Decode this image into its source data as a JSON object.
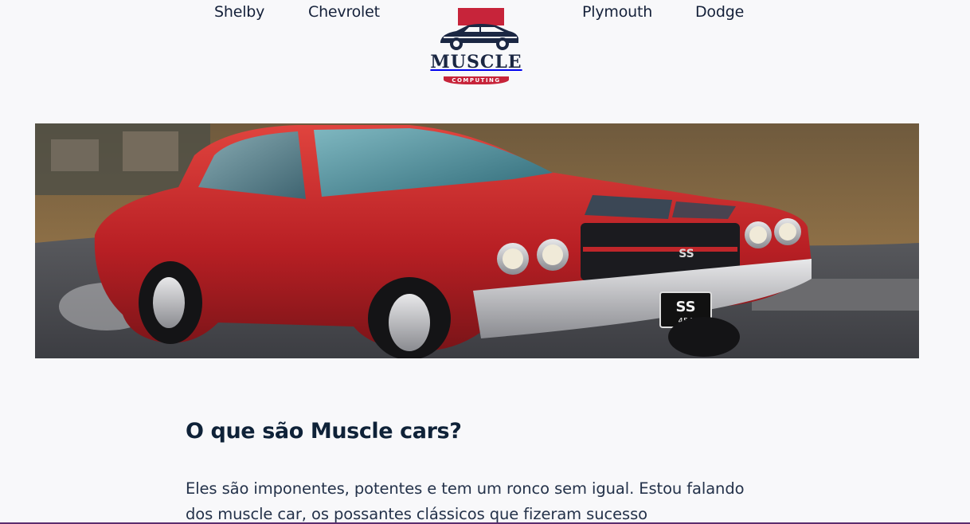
{
  "nav": {
    "left": [
      {
        "label": "Shelby"
      },
      {
        "label": "Chevrolet"
      }
    ],
    "right": [
      {
        "label": "Plymouth"
      },
      {
        "label": "Dodge"
      }
    ]
  },
  "logo": {
    "word": "MUSCLE",
    "ribbon": "COMPUTING",
    "icon": "muscle-car-logo-icon",
    "colors": {
      "red": "#c7243a",
      "navy": "#1b2743"
    }
  },
  "hero": {
    "image": "red-muscle-car-hero-image",
    "car_badge": "SS",
    "plate": {
      "line1": "SS",
      "line2": "454"
    }
  },
  "article": {
    "title": "O que são Muscle cars?",
    "body": "Eles são imponentes, potentes e tem um ronco sem igual. Estou falando dos muscle car, os possantes clássicos que fizeram sucesso"
  },
  "colors": {
    "background": "#f8f8fa",
    "text": "#0f2238",
    "accent_rule": "#5b2d6e",
    "car_red": "#c0262a"
  }
}
